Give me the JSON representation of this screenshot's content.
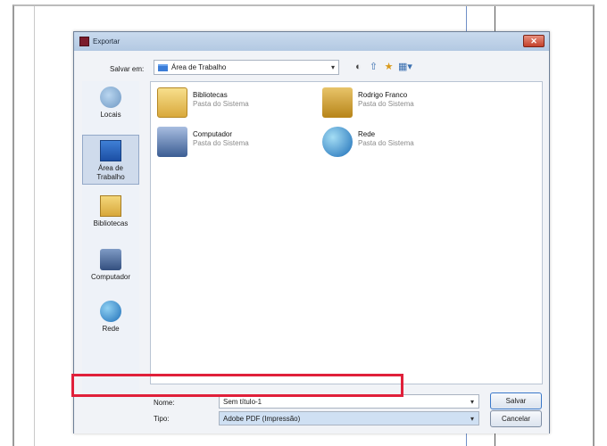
{
  "dialog": {
    "title": "Exportar",
    "close_icon": "close-icon"
  },
  "toolbar": {
    "save_in_label": "Salvar em:",
    "location_value": "Área de Trabalho",
    "back_glyph": "◐",
    "up_glyph": "⇧",
    "new_folder_glyph": "★",
    "views_glyph": "▦▾"
  },
  "places": [
    {
      "label": "Locais",
      "icon": "recent-places-icon"
    },
    {
      "label": "Área de Trabalho",
      "icon": "desktop-icon",
      "selected": true
    },
    {
      "label": "Bibliotecas",
      "icon": "libraries-icon"
    },
    {
      "label": "Computador",
      "icon": "computer-icon"
    },
    {
      "label": "Rede",
      "icon": "network-icon"
    }
  ],
  "files": [
    {
      "name": "Bibliotecas",
      "sub": "Pasta do Sistema",
      "icon": "libraries-folder-icon"
    },
    {
      "name": "Rodrigo Franco",
      "sub": "Pasta do Sistema",
      "icon": "user-folder-icon"
    },
    {
      "name": "Computador",
      "sub": "Pasta do Sistema",
      "icon": "computer-icon"
    },
    {
      "name": "Rede",
      "sub": "Pasta do Sistema",
      "icon": "network-icon"
    }
  ],
  "form": {
    "name_label": "Nome:",
    "name_value": "Sem título-1",
    "type_label": "Tipo:",
    "type_value": "Adobe PDF (Impressão)",
    "save_button": "Salvar",
    "cancel_button": "Cancelar",
    "dropdown_arrow": "▾"
  },
  "colors": {
    "highlight": "#e0203a",
    "titlebar": "#c9daee",
    "close": "#c4412a"
  }
}
